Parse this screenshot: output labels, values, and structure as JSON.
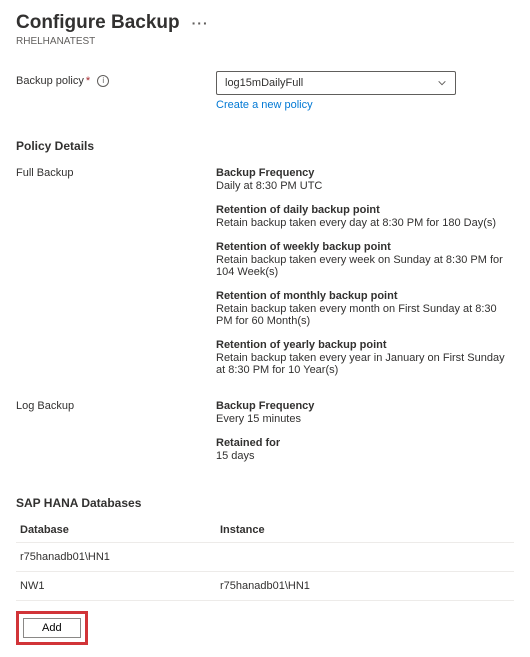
{
  "header": {
    "title": "Configure Backup",
    "subtitle": "RHELHANATEST"
  },
  "form": {
    "backup_policy_label": "Backup policy",
    "backup_policy_value": "log15mDailyFull",
    "create_policy_link": "Create a new policy"
  },
  "policy_details": {
    "heading": "Policy Details",
    "full_backup_label": "Full Backup",
    "log_backup_label": "Log Backup",
    "full_backup": {
      "freq_title": "Backup Frequency",
      "freq_text": "Daily at 8:30 PM UTC",
      "daily_title": "Retention of daily backup point",
      "daily_text": "Retain backup taken every day at 8:30 PM for 180 Day(s)",
      "weekly_title": "Retention of weekly backup point",
      "weekly_text": "Retain backup taken every week on Sunday at 8:30 PM for 104 Week(s)",
      "monthly_title": "Retention of monthly backup point",
      "monthly_text": "Retain backup taken every month on First Sunday at 8:30 PM for 60 Month(s)",
      "yearly_title": "Retention of yearly backup point",
      "yearly_text": "Retain backup taken every year in January on First Sunday at 8:30 PM for 10 Year(s)"
    },
    "log_backup": {
      "freq_title": "Backup Frequency",
      "freq_text": "Every 15 minutes",
      "retained_title": "Retained for",
      "retained_text": "15 days"
    }
  },
  "databases": {
    "heading": "SAP HANA Databases",
    "col_database": "Database",
    "col_instance": "Instance",
    "rows": [
      {
        "database": "r75hanadb01\\HN1",
        "instance": ""
      },
      {
        "database": "NW1",
        "instance": "r75hanadb01\\HN1"
      }
    ],
    "add_label": "Add"
  }
}
